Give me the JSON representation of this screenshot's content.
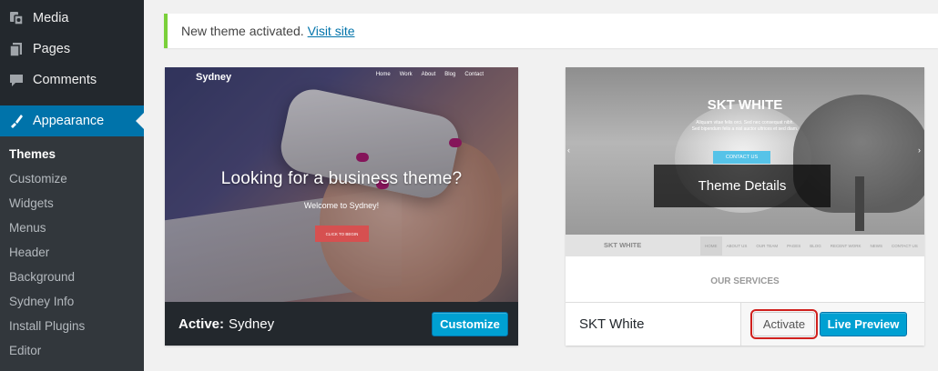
{
  "sidebar": {
    "menu": [
      {
        "label": "Media",
        "icon": "media-icon"
      },
      {
        "label": "Pages",
        "icon": "pages-icon"
      },
      {
        "label": "Comments",
        "icon": "comments-icon"
      },
      {
        "label": "Appearance",
        "icon": "appearance-icon",
        "current": true
      }
    ],
    "submenu": [
      {
        "label": "Themes",
        "active": true
      },
      {
        "label": "Customize"
      },
      {
        "label": "Widgets"
      },
      {
        "label": "Menus"
      },
      {
        "label": "Header"
      },
      {
        "label": "Background"
      },
      {
        "label": "Sydney Info"
      },
      {
        "label": "Install Plugins"
      },
      {
        "label": "Editor"
      }
    ]
  },
  "notice": {
    "text": "New theme activated.",
    "link": "Visit site",
    "accent_color": "#7ad03a"
  },
  "themes": {
    "active": {
      "status": "Active:",
      "name": "Sydney",
      "customize_label": "Customize",
      "screenshot": {
        "logo": "Sydney",
        "nav": [
          "Home",
          "Work",
          "About",
          "Blog",
          "Contact"
        ],
        "headline": "Looking for a business theme?",
        "subheadline": "Welcome to Sydney!",
        "cta": "CLICK TO BEGIN"
      }
    },
    "skt": {
      "name": "SKT White",
      "details_label": "Theme Details",
      "activate_label": "Activate",
      "preview_label": "Live Preview",
      "screenshot": {
        "title": "SKT WHITE",
        "desc_line1": "Aliquam vitae felis orci. Sed nec consequat nibh.",
        "desc_line2": "Sed bipendum felis a nisl auctor ultrices et sed diam.",
        "contact": "CONTACT US",
        "logo": "SKT WHITE",
        "nav": [
          "HOME",
          "ABOUT US",
          "OUR TEAM",
          "PAGES",
          "BLOG",
          "RECENT WORK",
          "NEWS",
          "CONTACT US"
        ],
        "services": "OUR SERVICES"
      }
    }
  },
  "colors": {
    "sidebar_bg": "#23282d",
    "submenu_bg": "#32373c",
    "current_menu": "#0073aa",
    "primary_button": "#00a0d2",
    "highlight_outline": "#d0201d"
  }
}
